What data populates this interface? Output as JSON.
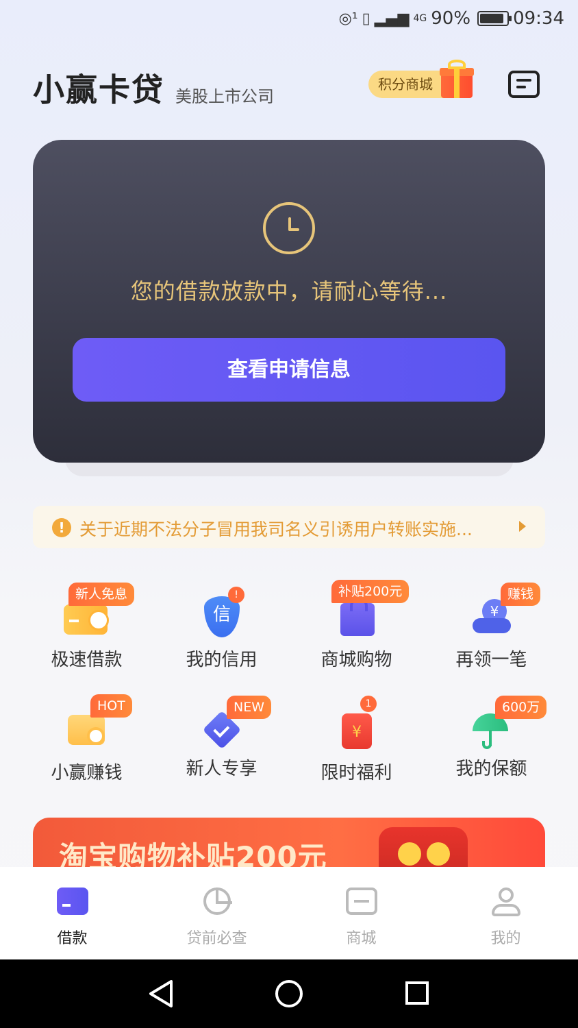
{
  "status_bar": {
    "network": "4G",
    "battery": "90%",
    "time": "09:34"
  },
  "header": {
    "brand": "小赢卡贷",
    "brand_sub": "美股上市公司",
    "points_mall": "积分商城"
  },
  "loan_card": {
    "status_text": "您的借款放款中，请耐心等待...",
    "cta_label": "查看申请信息"
  },
  "notice": {
    "text": "关于近期不法分子冒用我司名义引诱用户转账实施..."
  },
  "grid": [
    {
      "label": "极速借款",
      "badge": "新人免息",
      "icon": "card-bolt-icon"
    },
    {
      "label": "我的信用",
      "icon_text": "信",
      "dot": "!",
      "icon": "credit-shield-icon"
    },
    {
      "label": "商城购物",
      "badge": "补贴200元",
      "icon": "shopping-bag-icon"
    },
    {
      "label": "再领一笔",
      "badge": "赚钱",
      "icon_text": "¥",
      "icon": "hand-coin-icon"
    },
    {
      "label": "小赢赚钱",
      "badge": "HOT",
      "icon": "wallet-icon"
    },
    {
      "label": "新人专享",
      "badge": "NEW",
      "icon": "diamond-icon"
    },
    {
      "label": "限时福利",
      "dot": "1",
      "icon_text": "¥",
      "icon": "red-envelope-icon"
    },
    {
      "label": "我的保额",
      "badge": "600万",
      "icon": "umbrella-icon"
    }
  ],
  "banner": {
    "text": "淘宝购物补贴200元"
  },
  "tabs": [
    {
      "label": "借款",
      "icon": "card-icon",
      "active": true
    },
    {
      "label": "贷前必查",
      "icon": "pie-chart-icon",
      "active": false
    },
    {
      "label": "商城",
      "icon": "store-icon",
      "active": false
    },
    {
      "label": "我的",
      "icon": "user-icon",
      "active": false
    }
  ],
  "colors": {
    "accent": "#5a55f0",
    "gold": "#e7c57a",
    "notice": "#e39b35"
  }
}
